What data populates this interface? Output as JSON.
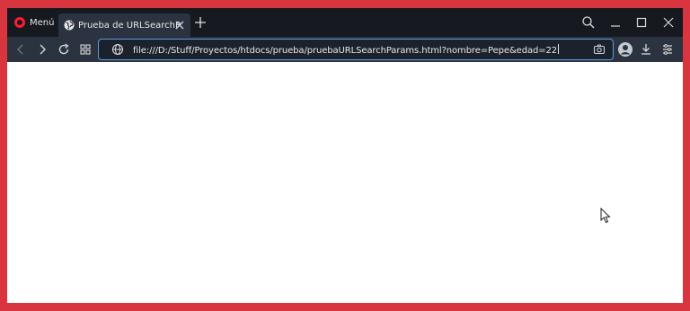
{
  "browser": {
    "menu_label": "Menú",
    "tab": {
      "title": "Prueba de URLSearchParams",
      "favicon": "globe-icon"
    },
    "address": {
      "url": "file:///D:/Stuff/Proyectos/htdocs/prueba/pruebaURLSearchParams.html?nombre=Pepe&edad=22"
    },
    "colors": {
      "frame_border": "#d8353f",
      "tabbar_bg": "#16191f",
      "toolbar_bg": "#2b3340",
      "url_focus": "#5a9be0",
      "opera_red": "#ff1b2d"
    }
  }
}
